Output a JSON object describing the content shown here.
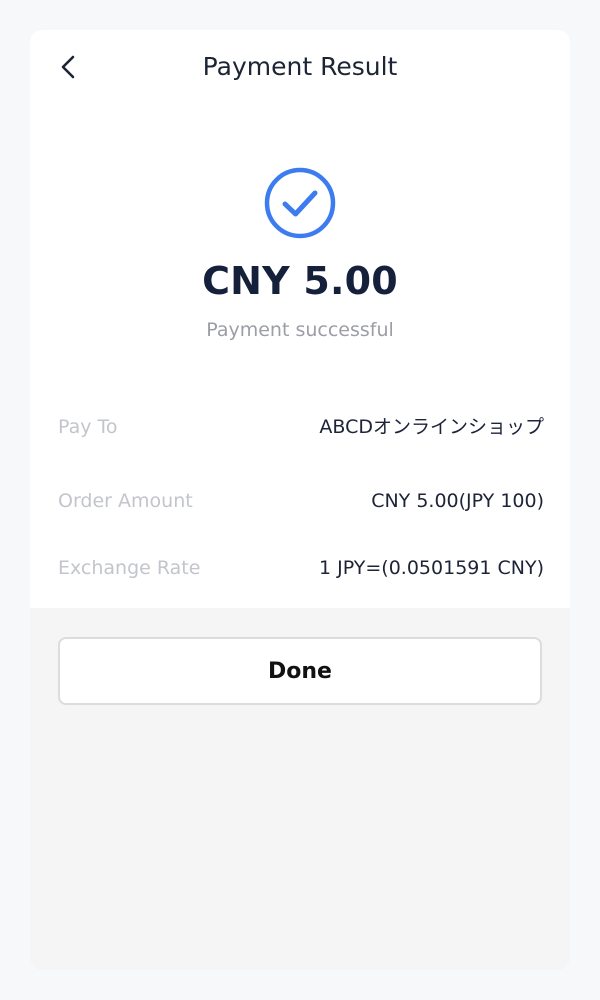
{
  "header": {
    "title": "Payment Result",
    "back_icon": "chevron-left-icon"
  },
  "result": {
    "icon": "check-circle-icon",
    "amount": "CNY 5.00",
    "status": "Payment successful",
    "accent_color": "#3d7bf0"
  },
  "details": [
    {
      "label": "Pay To",
      "value": "ABCDオンラインショップ"
    },
    {
      "label": "Order Amount",
      "value": "CNY 5.00(JPY 100)"
    },
    {
      "label": "Exchange Rate",
      "value": "1 JPY=(0.0501591 CNY)"
    }
  ],
  "actions": {
    "done_label": "Done"
  }
}
